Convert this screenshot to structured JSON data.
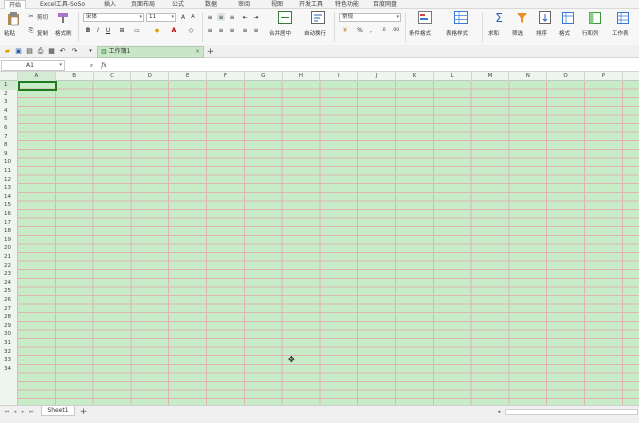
{
  "menubar": {
    "tabs": [
      "开始",
      "Excel工具-SoSo",
      "插入",
      "页面布局",
      "公式",
      "数据",
      "审阅",
      "视图",
      "开发工具",
      "特色功能",
      "百度网盘"
    ],
    "active_index": 0
  },
  "ribbon": {
    "paste_label": "粘贴",
    "cut_label": "剪切",
    "copy_label": "复制",
    "format_painter_label": "格式刷",
    "font_name": "宋体",
    "font_size": "11",
    "bold": "B",
    "italic": "I",
    "underline": "U",
    "merge_center_label": "合并居中",
    "wrap_text_label": "自动换行",
    "number_format": "常规",
    "percent": "%",
    "thousands": ",",
    "conditional_format_label": "条件格式",
    "table_style_label": "表格样式",
    "sum_label": "求和",
    "filter_label": "筛选",
    "sort_label": "排序",
    "format_label": "格式",
    "row_col_label": "行和列",
    "worksheet_label": "工作表"
  },
  "doc_tab": {
    "title": "工作簿1"
  },
  "formula_bar": {
    "cell_ref": "A1",
    "fx": "fx"
  },
  "grid": {
    "columns": [
      "A",
      "B",
      "C",
      "D",
      "E",
      "F",
      "G",
      "H",
      "I",
      "J",
      "K",
      "L",
      "M",
      "N",
      "O",
      "P"
    ],
    "rows": [
      "1",
      "2",
      "3",
      "4",
      "5",
      "6",
      "7",
      "8",
      "9",
      "10",
      "11",
      "12",
      "13",
      "14",
      "15",
      "16",
      "17",
      "18",
      "19",
      "20",
      "21",
      "22",
      "23",
      "24",
      "25",
      "26",
      "27",
      "28",
      "29",
      "30",
      "31",
      "32",
      "33",
      "34"
    ],
    "selected_cell": "A1"
  },
  "sheets": {
    "tabs": [
      "Sheet1"
    ],
    "add": "+"
  },
  "colors": {
    "cell_fill": "#c8ebc8",
    "grid_line": "#e0b4b4",
    "selection": "#1e7b1e"
  }
}
